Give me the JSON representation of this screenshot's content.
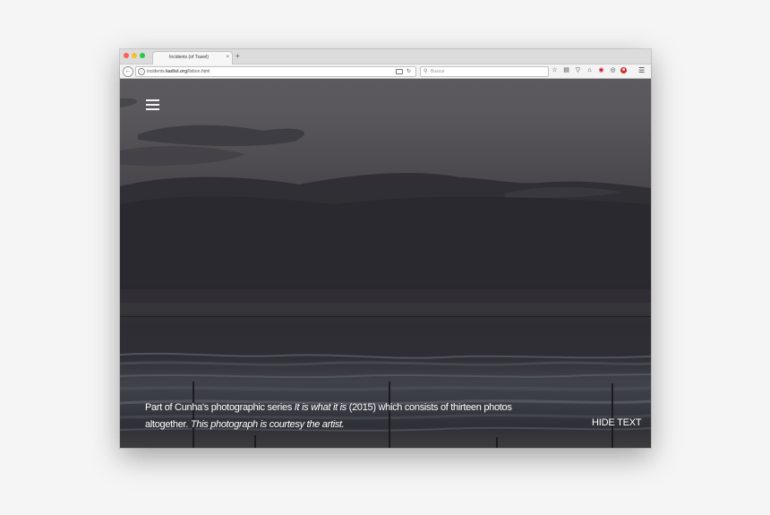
{
  "browser": {
    "tab_title": "Incidents (of Travel)",
    "tab_close": "×",
    "new_tab": "+",
    "url_prefix": "incidents.",
    "url_domain": "kadist.org",
    "url_path": "/lisbon.html",
    "search_placeholder": "Buscar",
    "icons": [
      "star-icon",
      "clipboard-icon",
      "pocket-icon",
      "home-icon",
      "pinterest-icon",
      "ghostery-icon",
      "ublock-icon",
      "menu-icon"
    ]
  },
  "page": {
    "caption": {
      "part1": "Part of Cunha's photographic series ",
      "series_title": "It is what it is",
      "part2": " (2015) which consists of thirteen photos altogether. ",
      "credit": "This photograph is courtesy the artist."
    },
    "hide_text_label": "HIDE TEXT"
  },
  "colors": {
    "sky": "#59575b",
    "sea": "#2e2e34",
    "traffic_red": "#fc5f57",
    "traffic_yellow": "#fdbc2e",
    "traffic_green": "#28c840"
  }
}
